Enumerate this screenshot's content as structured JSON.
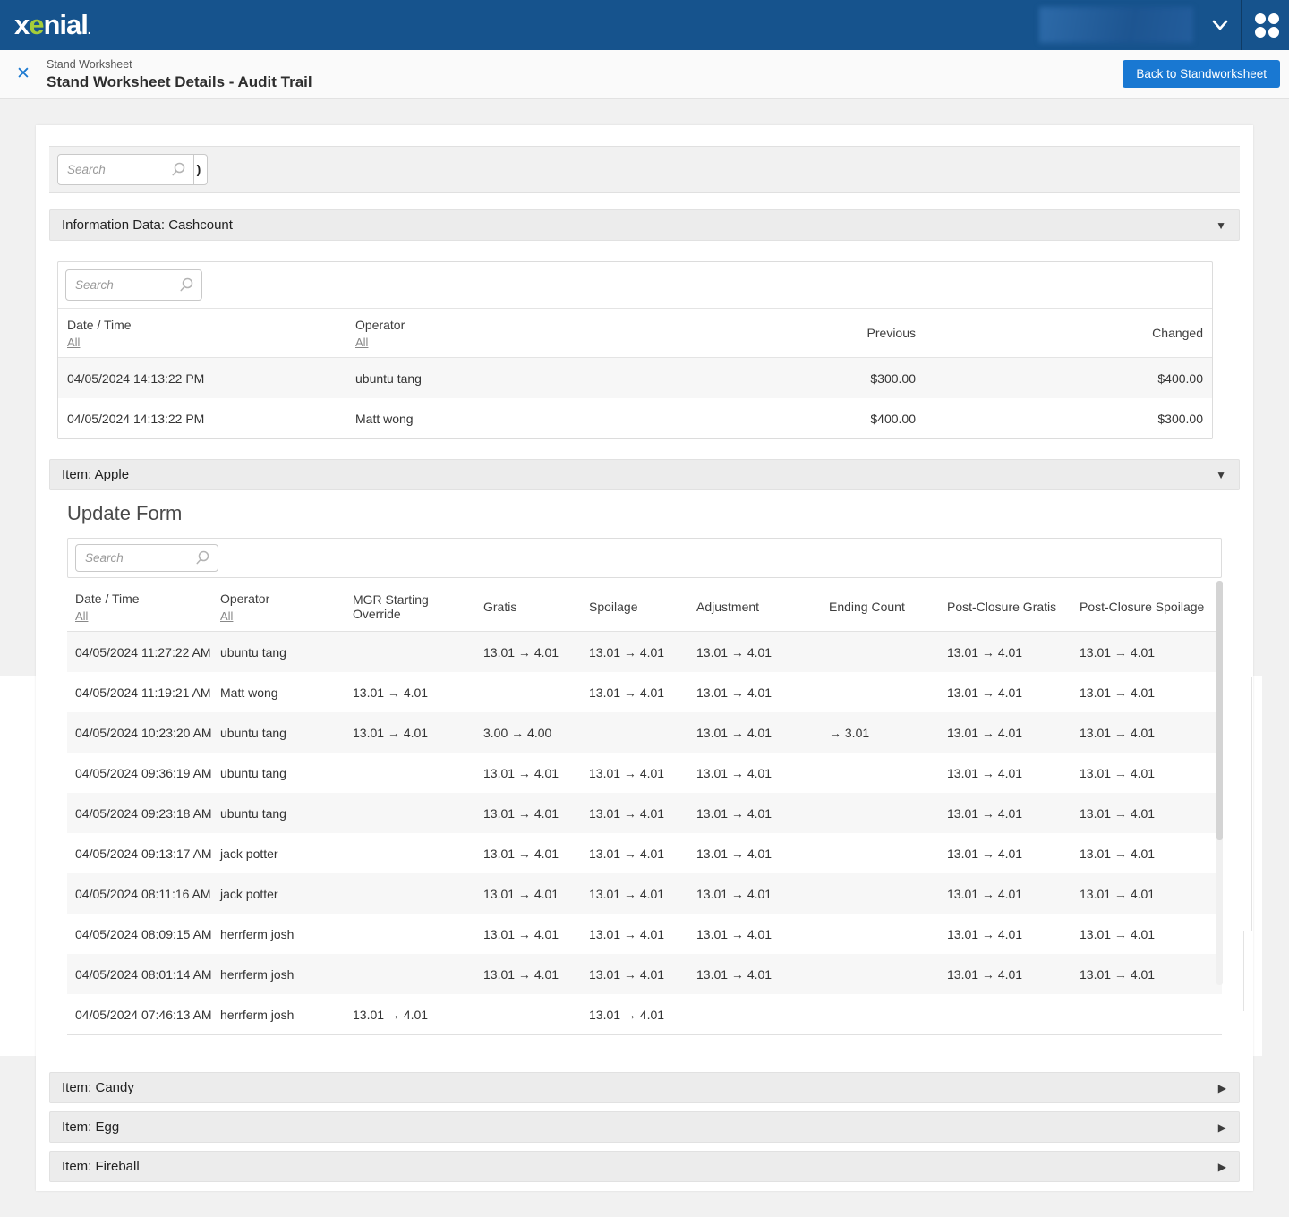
{
  "navbar": {
    "logo_part1": "x",
    "logo_accent": "e",
    "logo_part2": "nial",
    "logo_dot": ".",
    "logo_accent_color": "#a5cd3a",
    "bg_color": "#16538d"
  },
  "header": {
    "close_glyph": "✕",
    "breadcrumb": "Stand Worksheet",
    "title": "Stand Worksheet Details - Audit Trail",
    "back_button": "Back to Standworksheet",
    "accent_blue": "#1978d2"
  },
  "top_search": {
    "placeholder": "Search",
    "addon_glyph": ")"
  },
  "cashcount": {
    "title": "Information Data: Cashcount",
    "search_placeholder": "Search",
    "col_datetime": "Date / Time",
    "col_operator": "Operator",
    "col_previous": "Previous",
    "col_changed": "Changed",
    "filter_all": "All",
    "rows": [
      [
        "04/05/2024 14:13:22 PM",
        "ubuntu tang",
        "$300.00",
        "$400.00"
      ],
      [
        "04/05/2024 14:13:22 PM",
        "Matt wong",
        "$400.00",
        "$300.00"
      ]
    ]
  },
  "apple": {
    "title": "Item: Apple",
    "form_title": "Update Form",
    "search_placeholder": "Search",
    "filter_all": "All",
    "columns": [
      "Date / Time",
      "Operator",
      "MGR Starting Override",
      "Gratis",
      "Spoilage",
      "Adjustment",
      "Ending Count",
      "Post-Closure Gratis",
      "Post-Closure Spoilage"
    ],
    "rows": [
      [
        "04/05/2024 11:27:22 AM",
        "ubuntu tang",
        "",
        "13.01 → 4.01",
        "13.01 → 4.01",
        "13.01 → 4.01",
        "",
        "13.01 → 4.01",
        "13.01 → 4.01"
      ],
      [
        "04/05/2024 11:19:21 AM",
        "Matt wong",
        "13.01 → 4.01",
        "",
        "13.01 → 4.01",
        "13.01 → 4.01",
        "",
        "13.01 → 4.01",
        "13.01 → 4.01"
      ],
      [
        "04/05/2024 10:23:20 AM",
        "ubuntu tang",
        "13.01 → 4.01",
        "3.00 → 4.00",
        "",
        "13.01 → 4.01",
        "→ 3.01",
        "13.01 → 4.01",
        "13.01 → 4.01"
      ],
      [
        "04/05/2024 09:36:19 AM",
        "ubuntu tang",
        "",
        "13.01 → 4.01",
        "13.01 → 4.01",
        "13.01 → 4.01",
        "",
        "13.01 → 4.01",
        "13.01 → 4.01"
      ],
      [
        "04/05/2024 09:23:18 AM",
        "ubuntu tang",
        "",
        "13.01 → 4.01",
        "13.01 → 4.01",
        "13.01 → 4.01",
        "",
        "13.01 → 4.01",
        "13.01 → 4.01"
      ],
      [
        "04/05/2024 09:13:17 AM",
        "jack potter",
        "",
        "13.01 → 4.01",
        "13.01 → 4.01",
        "13.01 → 4.01",
        "",
        "13.01 → 4.01",
        "13.01 → 4.01"
      ],
      [
        "04/05/2024 08:11:16 AM",
        "jack potter",
        "",
        "13.01 → 4.01",
        "13.01 → 4.01",
        "13.01 → 4.01",
        "",
        "13.01 → 4.01",
        "13.01 → 4.01"
      ],
      [
        "04/05/2024 08:09:15 AM",
        "herrferm josh",
        "",
        "13.01 → 4.01",
        "13.01 → 4.01",
        "13.01 → 4.01",
        "",
        "13.01 → 4.01",
        "13.01 → 4.01"
      ],
      [
        "04/05/2024 08:01:14 AM",
        "herrferm josh",
        "",
        "13.01 → 4.01",
        "13.01 → 4.01",
        "13.01 → 4.01",
        "",
        "13.01 → 4.01",
        "13.01 → 4.01"
      ],
      [
        "04/05/2024 07:46:13 AM",
        "herrferm josh",
        "13.01 → 4.01",
        "",
        "13.01 → 4.01",
        "",
        "",
        "",
        ""
      ]
    ]
  },
  "collapsed_sections": [
    "Item: Candy",
    "Item: Egg",
    "Item: Fireball"
  ],
  "icons": {
    "expanded_caret": "▼",
    "collapsed_caret": "▶"
  }
}
